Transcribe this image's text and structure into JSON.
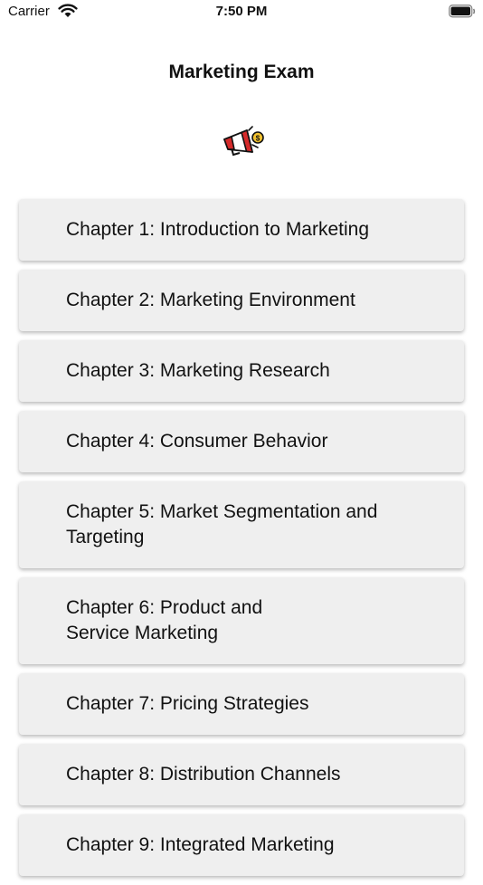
{
  "status_bar": {
    "carrier": "Carrier",
    "time": "7:50 PM"
  },
  "header": {
    "title": "Marketing Exam",
    "logo_icon": "megaphone-icon"
  },
  "chapters": [
    {
      "label": "Chapter 1: Introduction to Marketing"
    },
    {
      "label": "Chapter 2: Marketing Environment"
    },
    {
      "label": "Chapter 3: Marketing Research"
    },
    {
      "label": "Chapter 4: Consumer Behavior"
    },
    {
      "label": "Chapter 5: Market Segmentation and Targeting"
    },
    {
      "label": "Chapter 6: Product and Service Marketing"
    },
    {
      "label": "Chapter 7: Pricing Strategies"
    },
    {
      "label": "Chapter 8: Distribution Channels"
    },
    {
      "label": "Chapter 9: Integrated Marketing"
    }
  ],
  "colors": {
    "card_background": "#efefef",
    "megaphone_red": "#d62b2b",
    "coin_yellow": "#f2c230"
  }
}
